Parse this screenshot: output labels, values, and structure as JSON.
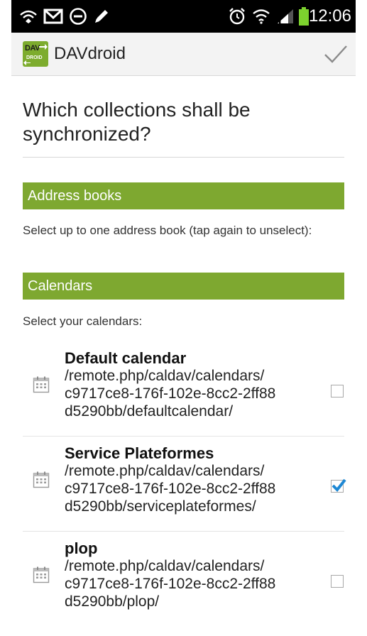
{
  "status_bar": {
    "time": "12:06",
    "battery_color": "#7dd22e"
  },
  "action_bar": {
    "logo_top": "DAV",
    "logo_bottom": "DROID",
    "title": "DAVdroid",
    "done_icon": "checkmark-icon"
  },
  "headline": "Which collections shall be synchronized?",
  "sections": {
    "address_books": {
      "title": "Address books",
      "hint": "Select up to one address book (tap again to unselect):"
    },
    "calendars": {
      "title": "Calendars",
      "hint": "Select your calendars:"
    }
  },
  "calendars": [
    {
      "name": "Default calendar",
      "path_lines": [
        "/remote.php/caldav/calendars/",
        "c9717ce8-176f-102e-8cc2-2ff88",
        "d5290bb/defaultcalendar/"
      ],
      "checked": false
    },
    {
      "name": "Service Plateformes",
      "path_lines": [
        "/remote.php/caldav/calendars/",
        "c9717ce8-176f-102e-8cc2-2ff88",
        "d5290bb/serviceplateformes/"
      ],
      "checked": true
    },
    {
      "name": "plop",
      "path_lines": [
        "/remote.php/caldav/calendars/",
        "c9717ce8-176f-102e-8cc2-2ff88",
        "d5290bb/plop/"
      ],
      "checked": false
    }
  ],
  "colors": {
    "section_header": "#7ea830",
    "checkbox_tick": "#1e88d4"
  }
}
